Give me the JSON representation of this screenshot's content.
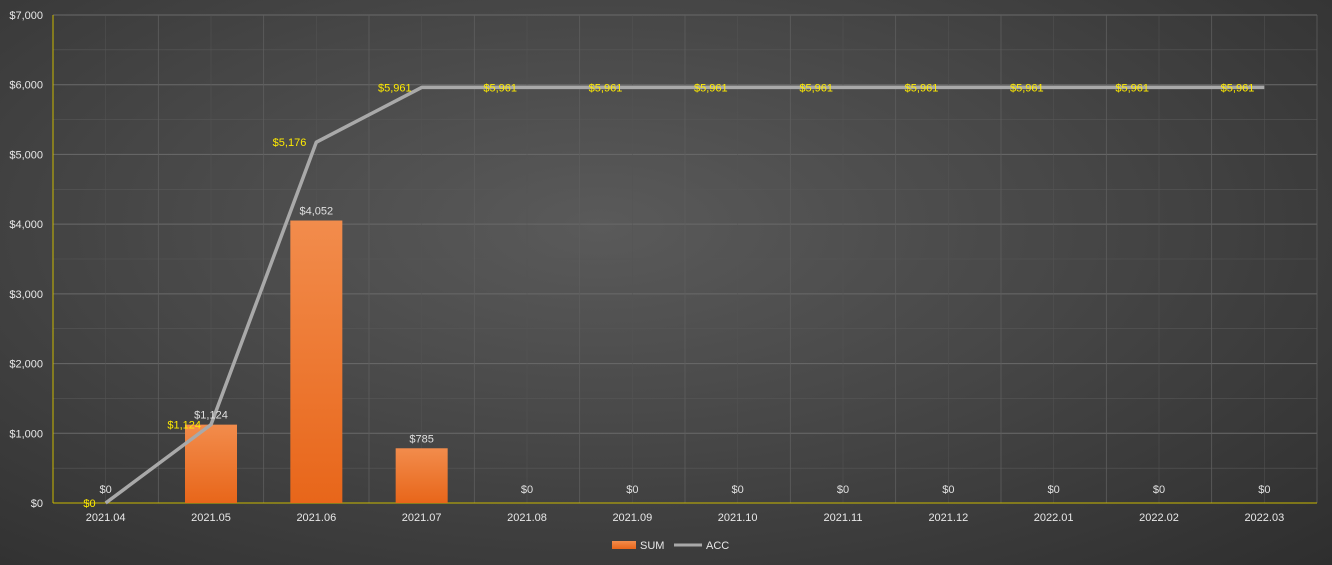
{
  "chart_data": {
    "type": "bar",
    "categories": [
      "2021.04",
      "2021.05",
      "2021.06",
      "2021.07",
      "2021.08",
      "2021.09",
      "2021.10",
      "2021.11",
      "2021.12",
      "2022.01",
      "2022.02",
      "2022.03"
    ],
    "series": [
      {
        "name": "SUM",
        "type": "bar",
        "values": [
          0,
          1124,
          4052,
          785,
          0,
          0,
          0,
          0,
          0,
          0,
          0,
          0
        ],
        "labels": [
          "$0",
          "$1,124",
          "$4,052",
          "$785",
          "$0",
          "$0",
          "$0",
          "$0",
          "$0",
          "$0",
          "$0",
          "$0"
        ],
        "color": "#f07a28"
      },
      {
        "name": "ACC",
        "type": "line",
        "values": [
          0,
          1124,
          5176,
          5961,
          5961,
          5961,
          5961,
          5961,
          5961,
          5961,
          5961,
          5961
        ],
        "labels": [
          "$0",
          "$1,124",
          "$5,176",
          "$5,961",
          "$5,961",
          "$5,961",
          "$5,961",
          "$5,961",
          "$5,961",
          "$5,961",
          "$5,961",
          "$5,961"
        ],
        "color": "#a9a9a9",
        "label_color": "#ffeb00"
      }
    ],
    "y_ticks": [
      "$0",
      "$1,000",
      "$2,000",
      "$3,000",
      "$4,000",
      "$5,000",
      "$6,000",
      "$7,000"
    ],
    "ylim": [
      0,
      7000
    ],
    "grid": true,
    "legend": "bottom-center",
    "title": "",
    "xlabel": "",
    "ylabel": ""
  }
}
